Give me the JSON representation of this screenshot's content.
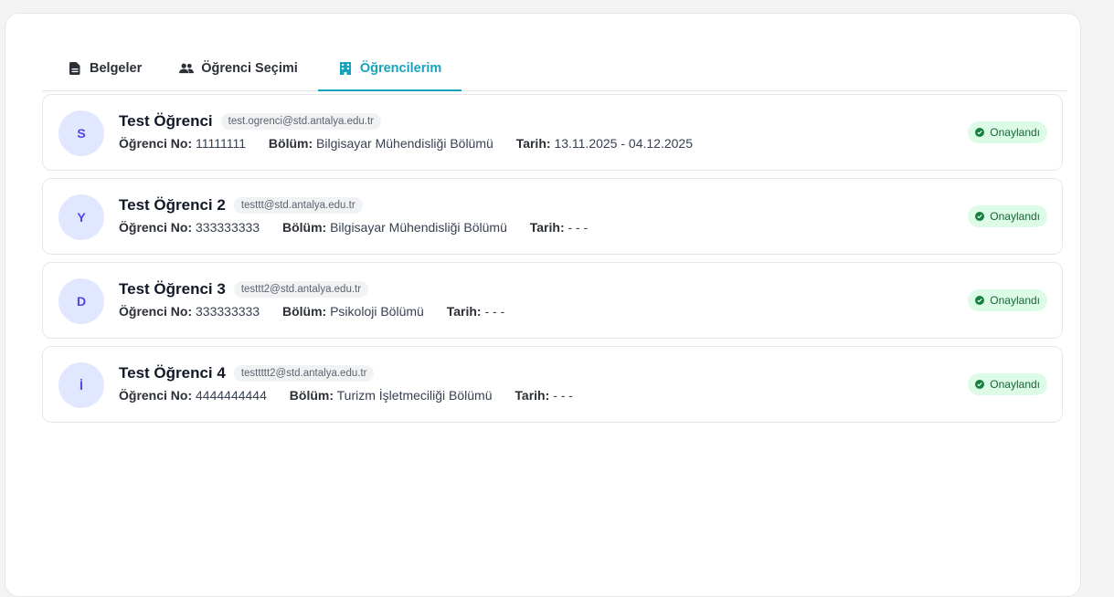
{
  "tabs": [
    {
      "label": "Belgeler",
      "icon": "document-icon",
      "active": false
    },
    {
      "label": "Öğrenci Seçimi",
      "icon": "users-icon",
      "active": false
    },
    {
      "label": "Öğrencilerim",
      "icon": "building-icon",
      "active": true
    }
  ],
  "labels": {
    "student_no": "Öğrenci No:",
    "department": "Bölüm:",
    "date": "Tarih:"
  },
  "students": [
    {
      "initial": "S",
      "name": "Test Öğrenci",
      "email": "test.ogrenci@std.antalya.edu.tr",
      "student_no": "11111111",
      "department": "Bilgisayar Mühendisliği Bölümü",
      "date": "13.11.2025 - 04.12.2025",
      "status": "Onaylandı"
    },
    {
      "initial": "Y",
      "name": "Test Öğrenci 2",
      "email": "testtt@std.antalya.edu.tr",
      "student_no": "333333333",
      "department": "Bilgisayar Mühendisliği Bölümü",
      "date": "- - -",
      "status": "Onaylandı"
    },
    {
      "initial": "D",
      "name": "Test Öğrenci 3",
      "email": "testtt2@std.antalya.edu.tr",
      "student_no": "333333333",
      "department": "Psikoloji Bölümü",
      "date": "- - -",
      "status": "Onaylandı"
    },
    {
      "initial": "İ",
      "name": "Test Öğrenci 4",
      "email": "testtttt2@std.antalya.edu.tr",
      "student_no": "4444444444",
      "department": "Turizm İşletmeciliği Bölümü",
      "date": "- - -",
      "status": "Onaylandı"
    }
  ],
  "colors": {
    "accent": "#16a3bd",
    "avatar_bg": "#e0e7ff",
    "avatar_fg": "#4f46e5",
    "badge_bg": "#dcfce7",
    "badge_fg": "#166534"
  }
}
